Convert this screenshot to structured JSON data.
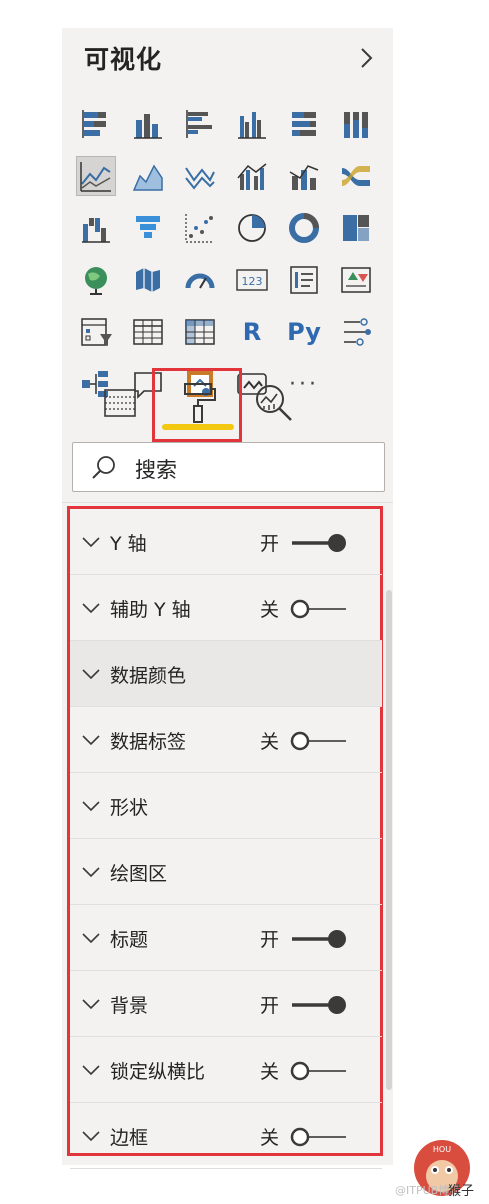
{
  "panel": {
    "title": "可视化",
    "collapse_icon": "chevron-right-icon"
  },
  "visuals": [
    {
      "name": "stacked-bar-chart-icon"
    },
    {
      "name": "stacked-column-chart-icon"
    },
    {
      "name": "clustered-bar-chart-icon"
    },
    {
      "name": "clustered-column-chart-icon"
    },
    {
      "name": "100-stacked-bar-chart-icon"
    },
    {
      "name": "100-stacked-column-chart-icon"
    },
    {
      "name": "line-chart-icon",
      "selected": true
    },
    {
      "name": "area-chart-icon"
    },
    {
      "name": "stacked-area-chart-icon"
    },
    {
      "name": "line-clustered-column-chart-icon"
    },
    {
      "name": "line-stacked-column-chart-icon"
    },
    {
      "name": "ribbon-chart-icon"
    },
    {
      "name": "waterfall-chart-icon"
    },
    {
      "name": "funnel-chart-icon"
    },
    {
      "name": "scatter-chart-icon"
    },
    {
      "name": "pie-chart-icon"
    },
    {
      "name": "donut-chart-icon"
    },
    {
      "name": "treemap-icon"
    },
    {
      "name": "map-icon"
    },
    {
      "name": "filled-map-icon"
    },
    {
      "name": "gauge-icon"
    },
    {
      "name": "card-icon",
      "text": "123"
    },
    {
      "name": "multi-row-card-icon"
    },
    {
      "name": "kpi-icon"
    },
    {
      "name": "slicer-icon"
    },
    {
      "name": "table-icon"
    },
    {
      "name": "matrix-icon"
    },
    {
      "name": "r-script-visual-icon",
      "text": "R"
    },
    {
      "name": "python-visual-icon",
      "text": "Py"
    },
    {
      "name": "key-influencers-icon"
    },
    {
      "name": "decomposition-tree-icon"
    },
    {
      "name": "qa-icon"
    },
    {
      "name": "smart-narrative-icon"
    },
    {
      "name": "paginated-report-icon"
    },
    {
      "name": "more-visuals-icon",
      "text": "···"
    }
  ],
  "tabs": [
    {
      "name": "fields-tab",
      "icon": "fields-icon"
    },
    {
      "name": "format-tab",
      "icon": "paint-roller-icon",
      "active": true
    },
    {
      "name": "analytics-tab",
      "icon": "analytics-icon"
    }
  ],
  "search": {
    "label": "搜索",
    "icon": "search-icon"
  },
  "sections": [
    {
      "label": "Y 轴",
      "state": "开",
      "on": true
    },
    {
      "label": "辅助 Y 轴",
      "state": "关",
      "on": false
    },
    {
      "label": "数据颜色",
      "state": "",
      "highlight": true
    },
    {
      "label": "数据标签",
      "state": "关",
      "on": false
    },
    {
      "label": "形状",
      "state": ""
    },
    {
      "label": "绘图区",
      "state": ""
    },
    {
      "label": "标题",
      "state": "开",
      "on": true
    },
    {
      "label": "背景",
      "state": "开",
      "on": true
    },
    {
      "label": "锁定纵横比",
      "state": "关",
      "on": false
    },
    {
      "label": "边框",
      "state": "关",
      "on": false
    }
  ],
  "watermark": {
    "text": "@ITPUB博客",
    "author": "猴子",
    "badge": "HOU"
  },
  "colors": {
    "accent_red": "#e2353b",
    "accent_yellow": "#f2c811",
    "panel_bg": "#f3f2f1",
    "toggle": "#3b3a39"
  }
}
